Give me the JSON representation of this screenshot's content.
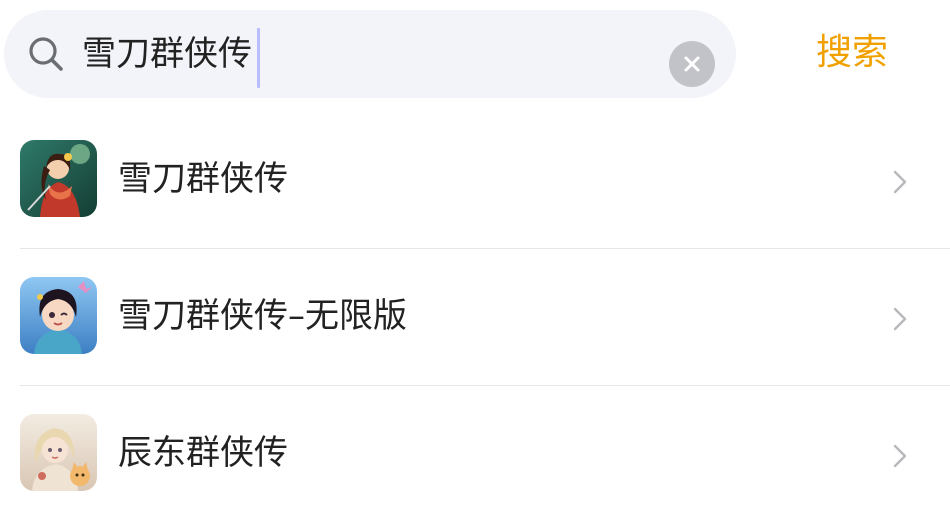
{
  "search": {
    "query": "雪刀群侠传",
    "submit_label": "搜索"
  },
  "colors": {
    "accent": "#f0a000",
    "search_background": "#f3f4f9",
    "clear_button": "#c2c3c8"
  },
  "results": [
    {
      "label": "雪刀群侠传",
      "icon": "game-icon-swordswoman"
    },
    {
      "label": "雪刀群侠传–无限版",
      "icon": "game-icon-winking-girl"
    },
    {
      "label": "辰东群侠传",
      "icon": "game-icon-fairy-with-cat"
    }
  ]
}
